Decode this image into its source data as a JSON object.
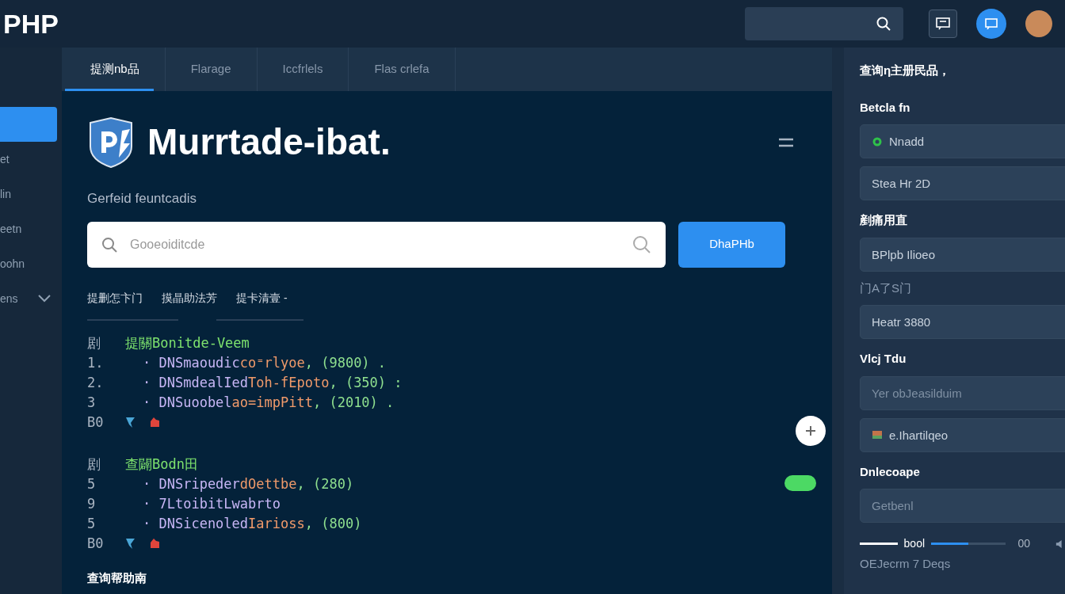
{
  "topbar": {
    "logo": "PHP"
  },
  "sidebar": {
    "items": [
      {
        "selected": true
      },
      {
        "label": "et",
        "selected": false
      },
      {
        "label": "lin",
        "selected": false
      },
      {
        "label": "eetn",
        "selected": false
      },
      {
        "label": "oohn",
        "selected": false
      },
      {
        "label": "ens",
        "selected": false,
        "expanded": false
      }
    ]
  },
  "tabs": [
    {
      "label": "提测nb品",
      "selected": true
    },
    {
      "label": "Flarage",
      "selected": false
    },
    {
      "label": "Iccfrlels",
      "selected": false
    },
    {
      "label": "Flas crlefa",
      "selected": false
    }
  ],
  "header": {
    "title": "Murrtade-ibat.",
    "subtitle": "Gerfeid feuntcadis"
  },
  "search": {
    "placeholder": "Gooeoiditcde",
    "button": "DhaPHb"
  },
  "links": [
    "提删怎卞门",
    "摸晶助法芳",
    "提卡清壹 -"
  ],
  "code_sections": [
    {
      "gutter": "剧",
      "heading": "提關Bonitde-Veem",
      "lines": [
        {
          "num": "1.",
          "kind": "code",
          "parts": [
            {
              "text": "· DNSmaoudic",
              "kind": "ident"
            },
            {
              "text": "co⁼rlyoe",
              "kind": "string"
            },
            {
              "text": ", (9800) .",
              "kind": "number"
            }
          ]
        },
        {
          "num": "2.",
          "kind": "code",
          "parts": [
            {
              "text": "· DNSmdealIed",
              "kind": "ident"
            },
            {
              "text": "Toh-fEpoto",
              "kind": "string"
            },
            {
              "text": ", (350) :",
              "kind": "number"
            }
          ]
        },
        {
          "num": "3",
          "kind": "code",
          "parts": [
            {
              "text": "· DNSuoobel",
              "kind": "ident"
            },
            {
              "text": "ao=impPitt",
              "kind": "string"
            },
            {
              "text": ", (2010) .",
              "kind": "number"
            }
          ]
        },
        {
          "num": "B0",
          "kind": "marks"
        }
      ]
    },
    {
      "gutter": "剧",
      "heading": "查闢Bodn田",
      "lines": [
        {
          "num": "5",
          "kind": "code",
          "parts": [
            {
              "text": "· DNSripeder",
              "kind": "ident"
            },
            {
              "text": "dOettbe",
              "kind": "string"
            },
            {
              "text": ", (280)",
              "kind": "number"
            }
          ]
        },
        {
          "num": "9",
          "kind": "code",
          "parts": [
            {
              "text": "· 7LtoibitLwabrto",
              "kind": "ident"
            }
          ]
        },
        {
          "num": "5",
          "kind": "code",
          "parts": [
            {
              "text": "· DNSicenoled",
              "kind": "ident"
            },
            {
              "text": "Iarioss",
              "kind": "string"
            },
            {
              "text": ", (800)",
              "kind": "number"
            }
          ]
        },
        {
          "num": "B0",
          "kind": "marks"
        }
      ]
    }
  ],
  "footer_heading": "查询帮助南",
  "toggle": {
    "on": true
  },
  "panel": {
    "heading": "查询η主册民品，",
    "items": [
      {
        "kind": "label",
        "text": "Betcla fn"
      },
      {
        "kind": "status_field",
        "value": "Nnadd"
      },
      {
        "kind": "field",
        "value": "Stea Hr 2D"
      },
      {
        "kind": "label",
        "text": "剷痛用直"
      },
      {
        "kind": "field",
        "value": "BPlpb Ilioeo"
      },
      {
        "kind": "sublabel",
        "text": "门A了S门"
      },
      {
        "kind": "field",
        "value": "Heatr 3880"
      },
      {
        "kind": "label",
        "text": "Vlcj Tdu"
      },
      {
        "kind": "field",
        "placeholder": "Yer obJeasilduim"
      },
      {
        "kind": "image_field",
        "value": "e.Ihartilqeo"
      },
      {
        "kind": "label",
        "text": "Dnlecoape"
      },
      {
        "kind": "field",
        "placeholder": "Getbenl"
      },
      {
        "kind": "slider",
        "start": "bool",
        "level": 0.5,
        "end": "00"
      },
      {
        "kind": "sublabel",
        "text": "OEJecrm 7 Deqs"
      }
    ]
  }
}
